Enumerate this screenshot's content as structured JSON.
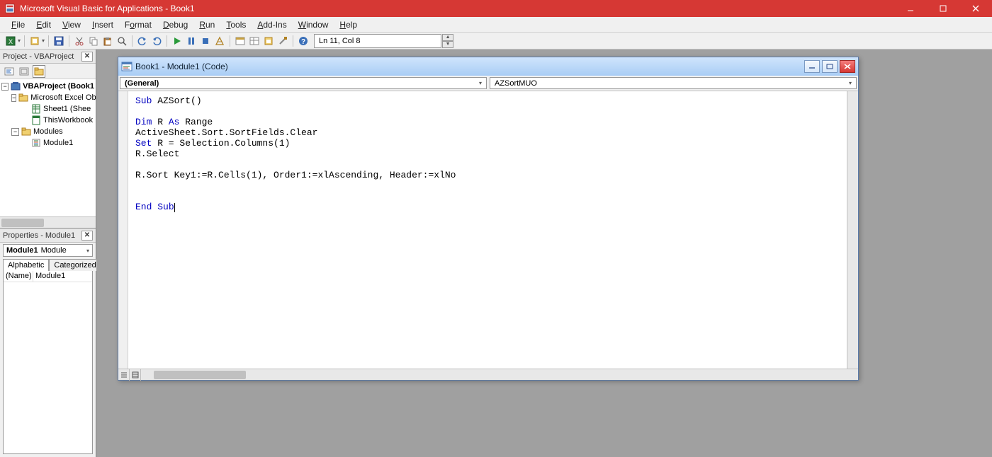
{
  "titlebar": {
    "title": "Microsoft Visual Basic for Applications - Book1"
  },
  "menus": [
    "File",
    "Edit",
    "View",
    "Insert",
    "Format",
    "Debug",
    "Run",
    "Tools",
    "Add-Ins",
    "Window",
    "Help"
  ],
  "cursor_position": "Ln 11, Col 8",
  "project_panel": {
    "title": "Project - VBAProject",
    "root": "VBAProject (Book1",
    "excel_objects": "Microsoft Excel Ob",
    "sheet1": "Sheet1 (Shee",
    "thisworkbook": "ThisWorkbook",
    "modules": "Modules",
    "module1": "Module1"
  },
  "properties_panel": {
    "title": "Properties - Module1",
    "combo_name": "Module1",
    "combo_type": "Module",
    "tabs": [
      "Alphabetic",
      "Categorized"
    ],
    "rows": [
      {
        "k": "(Name)",
        "v": "Module1"
      }
    ]
  },
  "code_window": {
    "title": "Book1 - Module1 (Code)",
    "object_combo": "(General)",
    "proc_combo": "AZSortMUO",
    "code": {
      "l1_a": "Sub",
      "l1_b": " AZSort()",
      "l3_a": "Dim",
      "l3_b": " R ",
      "l3_c": "As",
      "l3_d": " Range",
      "l4": "ActiveSheet.Sort.SortFields.Clear",
      "l5_a": "Set",
      "l5_b": " R = Selection.Columns(1)",
      "l6": "R.Select",
      "l8": "R.Sort Key1:=R.Cells(1), Order1:=xlAscending, Header:=xlNo",
      "l11_a": "End",
      "l11_b": " ",
      "l11_c": "Sub"
    }
  }
}
